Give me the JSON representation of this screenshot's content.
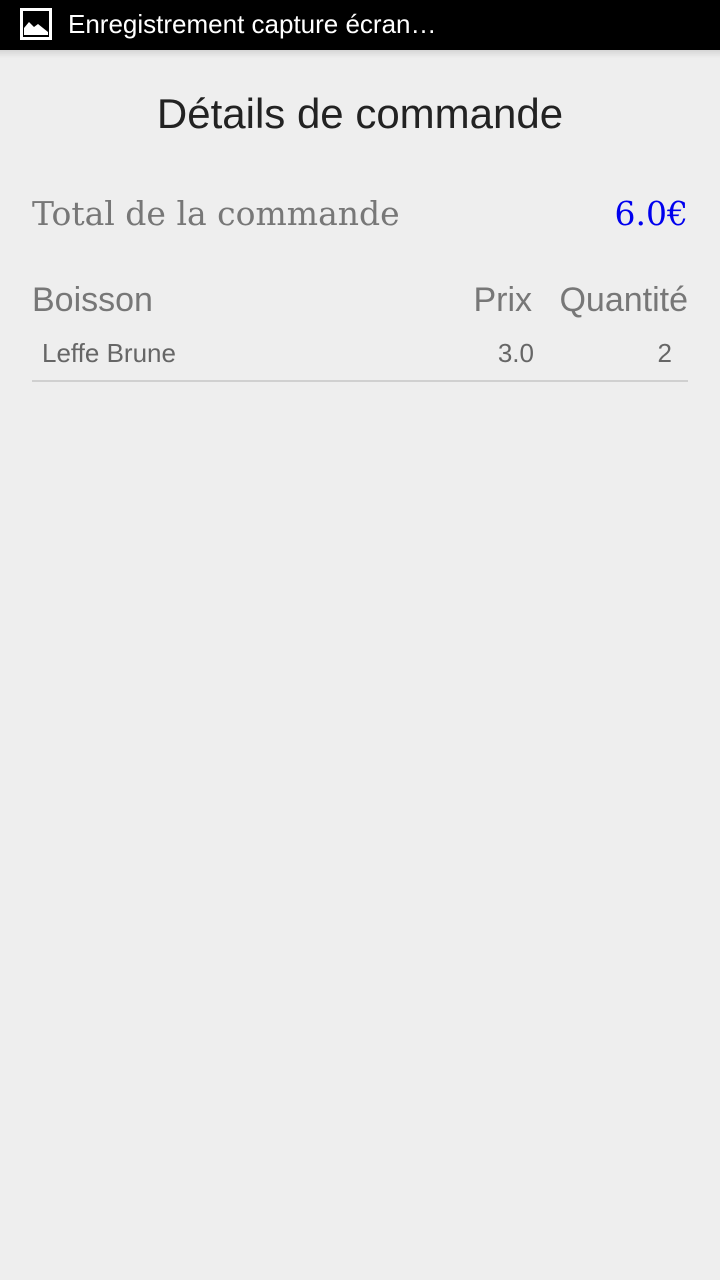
{
  "status_bar": {
    "notification_icon": "image-icon",
    "notification_text": "Enregistrement capture écran…"
  },
  "page": {
    "title": "Détails de commande"
  },
  "order_total": {
    "label": "Total de la commande",
    "value": "6.0€",
    "value_color": "#0000ee"
  },
  "table": {
    "headers": {
      "boisson": "Boisson",
      "prix": "Prix",
      "quantite": "Quantité"
    },
    "rows": [
      {
        "boisson": "Leffe Brune",
        "prix": "3.0",
        "quantite": "2"
      }
    ]
  }
}
